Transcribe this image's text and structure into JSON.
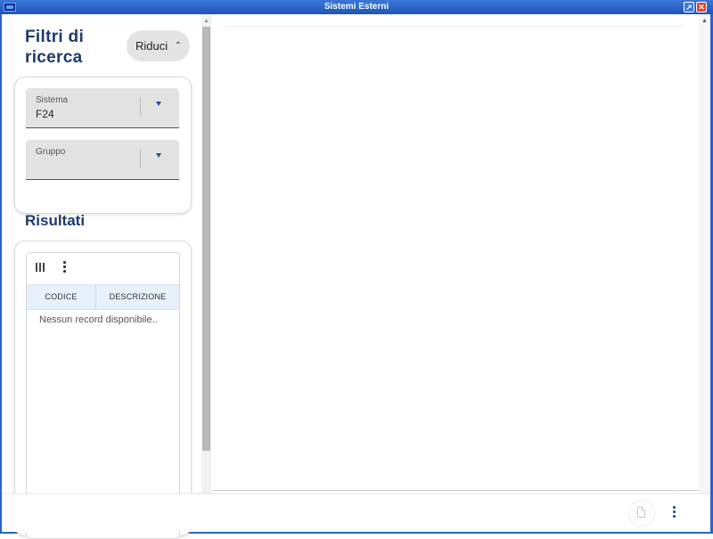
{
  "window": {
    "title": "Sistemi Esterni",
    "title_top": "........",
    "colors": {
      "titlebar": "#2a64c8",
      "accent": "#1d3b6a",
      "close": "#d8462c"
    }
  },
  "filters": {
    "title": "Filtri di ricerca",
    "collapse_label": "Riduci",
    "sistema": {
      "label": "Sistema",
      "value": "F24"
    },
    "gruppo": {
      "label": "Gruppo",
      "value": ""
    }
  },
  "results": {
    "title": "Risultati",
    "columns": [
      "CODICE",
      "DESCRIZIONE"
    ],
    "empty_message": "Nessun record disponibile.."
  },
  "icons": {
    "app": "app-icon",
    "restore": "restore-icon",
    "close": "close-icon",
    "columns": "columns-icon",
    "more": "more-vert-icon",
    "chevron": "chevron-up-icon",
    "dropdown": "dropdown-arrow-icon",
    "document": "document-icon"
  }
}
